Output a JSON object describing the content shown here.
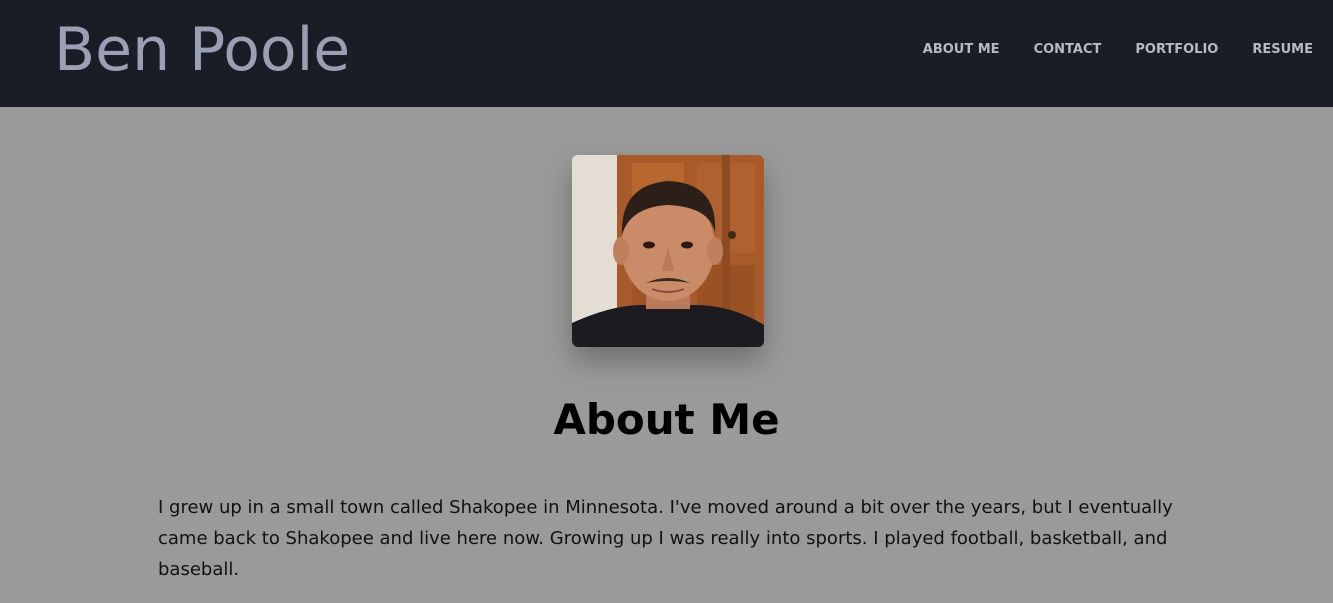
{
  "header": {
    "site_title": "Ben Poole",
    "nav": [
      {
        "label": "ABOUT ME"
      },
      {
        "label": "CONTACT"
      },
      {
        "label": "PORTFOLIO"
      },
      {
        "label": "RESUME"
      }
    ]
  },
  "main": {
    "heading": "About Me",
    "bio": "I grew up in a small town called Shakopee in Minnesota. I've moved around a bit over the years, but I eventually came back to Shakopee and live here now. Growing up I was really into sports. I played football, basketball, and baseball."
  },
  "colors": {
    "header_bg": "#1a1d25",
    "page_bg": "#9a9a9a",
    "title_color": "#9aa0b4",
    "nav_color": "#b6bac6"
  }
}
